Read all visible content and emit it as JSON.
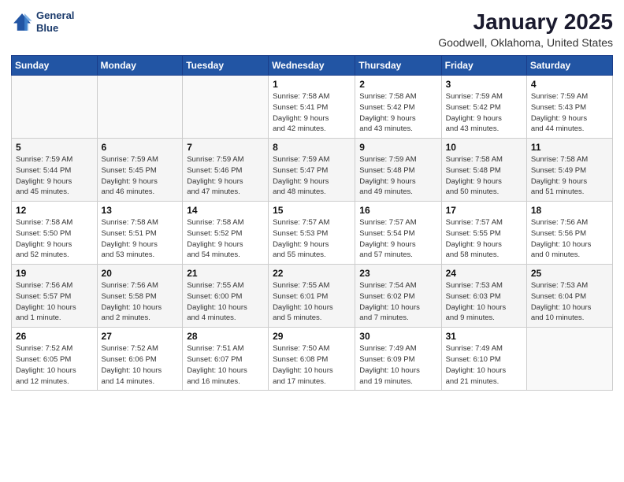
{
  "logo": {
    "line1": "General",
    "line2": "Blue"
  },
  "title": "January 2025",
  "location": "Goodwell, Oklahoma, United States",
  "days_of_week": [
    "Sunday",
    "Monday",
    "Tuesday",
    "Wednesday",
    "Thursday",
    "Friday",
    "Saturday"
  ],
  "weeks": [
    [
      {
        "day": "",
        "detail": ""
      },
      {
        "day": "",
        "detail": ""
      },
      {
        "day": "",
        "detail": ""
      },
      {
        "day": "1",
        "detail": "Sunrise: 7:58 AM\nSunset: 5:41 PM\nDaylight: 9 hours\nand 42 minutes."
      },
      {
        "day": "2",
        "detail": "Sunrise: 7:58 AM\nSunset: 5:42 PM\nDaylight: 9 hours\nand 43 minutes."
      },
      {
        "day": "3",
        "detail": "Sunrise: 7:59 AM\nSunset: 5:42 PM\nDaylight: 9 hours\nand 43 minutes."
      },
      {
        "day": "4",
        "detail": "Sunrise: 7:59 AM\nSunset: 5:43 PM\nDaylight: 9 hours\nand 44 minutes."
      }
    ],
    [
      {
        "day": "5",
        "detail": "Sunrise: 7:59 AM\nSunset: 5:44 PM\nDaylight: 9 hours\nand 45 minutes."
      },
      {
        "day": "6",
        "detail": "Sunrise: 7:59 AM\nSunset: 5:45 PM\nDaylight: 9 hours\nand 46 minutes."
      },
      {
        "day": "7",
        "detail": "Sunrise: 7:59 AM\nSunset: 5:46 PM\nDaylight: 9 hours\nand 47 minutes."
      },
      {
        "day": "8",
        "detail": "Sunrise: 7:59 AM\nSunset: 5:47 PM\nDaylight: 9 hours\nand 48 minutes."
      },
      {
        "day": "9",
        "detail": "Sunrise: 7:59 AM\nSunset: 5:48 PM\nDaylight: 9 hours\nand 49 minutes."
      },
      {
        "day": "10",
        "detail": "Sunrise: 7:58 AM\nSunset: 5:48 PM\nDaylight: 9 hours\nand 50 minutes."
      },
      {
        "day": "11",
        "detail": "Sunrise: 7:58 AM\nSunset: 5:49 PM\nDaylight: 9 hours\nand 51 minutes."
      }
    ],
    [
      {
        "day": "12",
        "detail": "Sunrise: 7:58 AM\nSunset: 5:50 PM\nDaylight: 9 hours\nand 52 minutes."
      },
      {
        "day": "13",
        "detail": "Sunrise: 7:58 AM\nSunset: 5:51 PM\nDaylight: 9 hours\nand 53 minutes."
      },
      {
        "day": "14",
        "detail": "Sunrise: 7:58 AM\nSunset: 5:52 PM\nDaylight: 9 hours\nand 54 minutes."
      },
      {
        "day": "15",
        "detail": "Sunrise: 7:57 AM\nSunset: 5:53 PM\nDaylight: 9 hours\nand 55 minutes."
      },
      {
        "day": "16",
        "detail": "Sunrise: 7:57 AM\nSunset: 5:54 PM\nDaylight: 9 hours\nand 57 minutes."
      },
      {
        "day": "17",
        "detail": "Sunrise: 7:57 AM\nSunset: 5:55 PM\nDaylight: 9 hours\nand 58 minutes."
      },
      {
        "day": "18",
        "detail": "Sunrise: 7:56 AM\nSunset: 5:56 PM\nDaylight: 10 hours\nand 0 minutes."
      }
    ],
    [
      {
        "day": "19",
        "detail": "Sunrise: 7:56 AM\nSunset: 5:57 PM\nDaylight: 10 hours\nand 1 minute."
      },
      {
        "day": "20",
        "detail": "Sunrise: 7:56 AM\nSunset: 5:58 PM\nDaylight: 10 hours\nand 2 minutes."
      },
      {
        "day": "21",
        "detail": "Sunrise: 7:55 AM\nSunset: 6:00 PM\nDaylight: 10 hours\nand 4 minutes."
      },
      {
        "day": "22",
        "detail": "Sunrise: 7:55 AM\nSunset: 6:01 PM\nDaylight: 10 hours\nand 5 minutes."
      },
      {
        "day": "23",
        "detail": "Sunrise: 7:54 AM\nSunset: 6:02 PM\nDaylight: 10 hours\nand 7 minutes."
      },
      {
        "day": "24",
        "detail": "Sunrise: 7:53 AM\nSunset: 6:03 PM\nDaylight: 10 hours\nand 9 minutes."
      },
      {
        "day": "25",
        "detail": "Sunrise: 7:53 AM\nSunset: 6:04 PM\nDaylight: 10 hours\nand 10 minutes."
      }
    ],
    [
      {
        "day": "26",
        "detail": "Sunrise: 7:52 AM\nSunset: 6:05 PM\nDaylight: 10 hours\nand 12 minutes."
      },
      {
        "day": "27",
        "detail": "Sunrise: 7:52 AM\nSunset: 6:06 PM\nDaylight: 10 hours\nand 14 minutes."
      },
      {
        "day": "28",
        "detail": "Sunrise: 7:51 AM\nSunset: 6:07 PM\nDaylight: 10 hours\nand 16 minutes."
      },
      {
        "day": "29",
        "detail": "Sunrise: 7:50 AM\nSunset: 6:08 PM\nDaylight: 10 hours\nand 17 minutes."
      },
      {
        "day": "30",
        "detail": "Sunrise: 7:49 AM\nSunset: 6:09 PM\nDaylight: 10 hours\nand 19 minutes."
      },
      {
        "day": "31",
        "detail": "Sunrise: 7:49 AM\nSunset: 6:10 PM\nDaylight: 10 hours\nand 21 minutes."
      },
      {
        "day": "",
        "detail": ""
      }
    ]
  ]
}
